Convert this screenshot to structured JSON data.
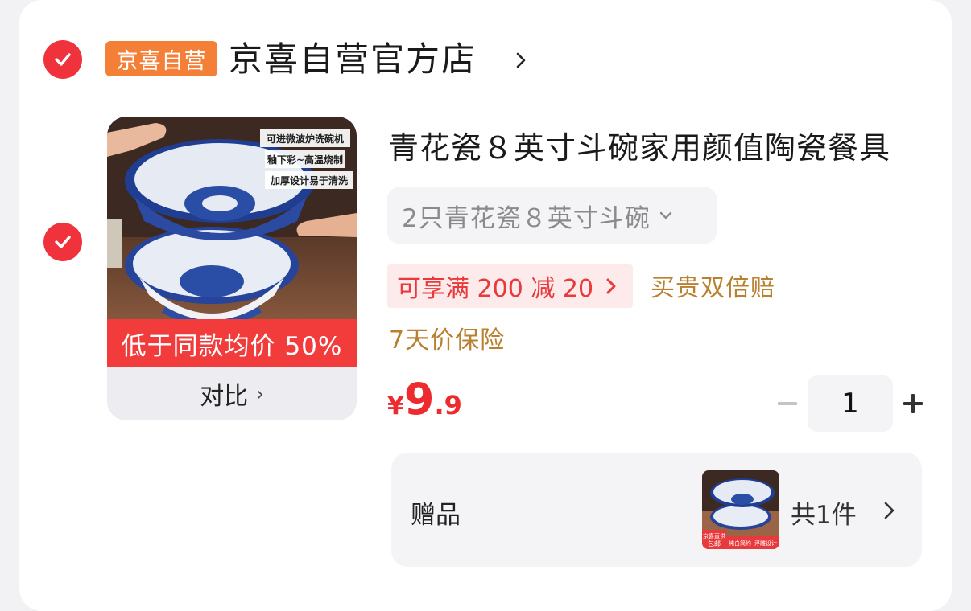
{
  "store": {
    "badge": "京喜自营",
    "name": "京喜自营官方店",
    "badge_color": "#f47f36"
  },
  "product": {
    "title": "青花瓷８英寸斗碗家用颜值陶瓷餐具",
    "image_tags": [
      "可进微波炉洗碗机",
      "釉下彩~高温烧制",
      "加厚设计易于清洗"
    ],
    "price_strip": "低于同款均价 50%",
    "compare_label": "对比",
    "spec": "2只青花瓷８英寸斗碗",
    "promo": "可享满 200 减 20",
    "guarantee": "买贵双倍赔",
    "insurance": "7天价保险",
    "price": {
      "currency": "¥",
      "integer": "9",
      "decimal": ".9"
    },
    "quantity": "1",
    "accent_color": "#ed2a2e"
  },
  "gift": {
    "label": "赠品",
    "count": "共1件",
    "thumb_tags": [
      "京喜直供",
      "包邮",
      "纯白简约",
      "浮雕设计"
    ]
  }
}
